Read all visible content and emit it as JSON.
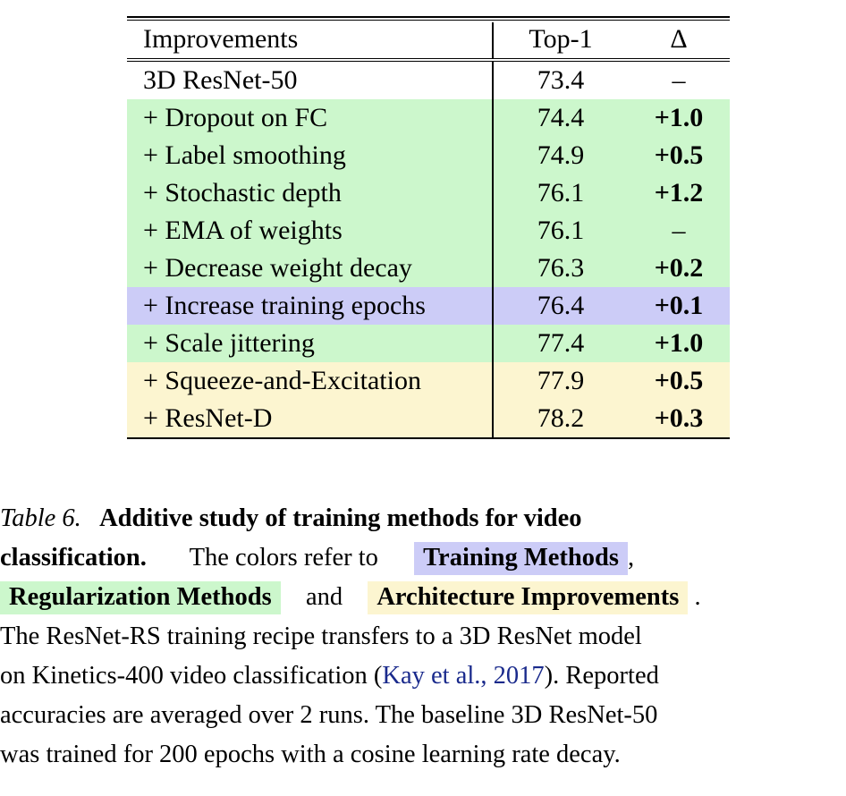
{
  "table": {
    "columns": [
      "Improvements",
      "Top-1",
      "Δ"
    ],
    "rows": [
      {
        "improvement": "3D ResNet-50",
        "top1": "73.4",
        "delta": "–",
        "color": "white",
        "delta_bold": false
      },
      {
        "improvement": "+ Dropout on FC",
        "top1": "74.4",
        "delta": "+1.0",
        "color": "green",
        "delta_bold": true
      },
      {
        "improvement": "+ Label smoothing",
        "top1": "74.9",
        "delta": "+0.5",
        "color": "green",
        "delta_bold": true
      },
      {
        "improvement": "+ Stochastic depth",
        "top1": "76.1",
        "delta": "+1.2",
        "color": "green",
        "delta_bold": true
      },
      {
        "improvement": "+ EMA of weights",
        "top1": "76.1",
        "delta": "–",
        "color": "green",
        "delta_bold": false
      },
      {
        "improvement": "+ Decrease weight decay",
        "top1": "76.3",
        "delta": "+0.2",
        "color": "green",
        "delta_bold": true
      },
      {
        "improvement": "+ Increase training epochs",
        "top1": "76.4",
        "delta": "+0.1",
        "color": "purple",
        "delta_bold": true
      },
      {
        "improvement": "+ Scale jittering",
        "top1": "77.4",
        "delta": "+1.0",
        "color": "green",
        "delta_bold": true
      },
      {
        "improvement": "+ Squeeze-and-Excitation",
        "top1": "77.9",
        "delta": "+0.5",
        "color": "yellow",
        "delta_bold": true
      },
      {
        "improvement": "+ ResNet-D",
        "top1": "78.2",
        "delta": "+0.3",
        "color": "yellow",
        "delta_bold": true
      }
    ]
  },
  "colors": {
    "green": "#ccf7cc",
    "purple": "#ccccf7",
    "yellow": "#fcf5d0",
    "citation_link": "#1a2a8c",
    "rule": "#000000"
  },
  "caption": {
    "label": "Table 6.",
    "title_line1": "Additive  study  of  training  methods  for  video",
    "title_line2": "classification.",
    "text_after_title": "The  colors  refer  to",
    "highlight_training": "Training Methods",
    "comma": ",",
    "highlight_regularization": "Regularization Methods",
    "conjunction": "and",
    "highlight_architecture": "Architecture Improvements",
    "period": ".",
    "line4": "The ResNet-RS training recipe transfers to a 3D ResNet model",
    "line5_a": "on Kinetics-400 video classification (",
    "line5_cite": "Kay et al., 2017",
    "line5_b": "). Reported",
    "line6": "accuracies are averaged over 2 runs. The baseline 3D ResNet-50",
    "line7": "was trained for 200 epochs with a cosine learning rate decay."
  }
}
